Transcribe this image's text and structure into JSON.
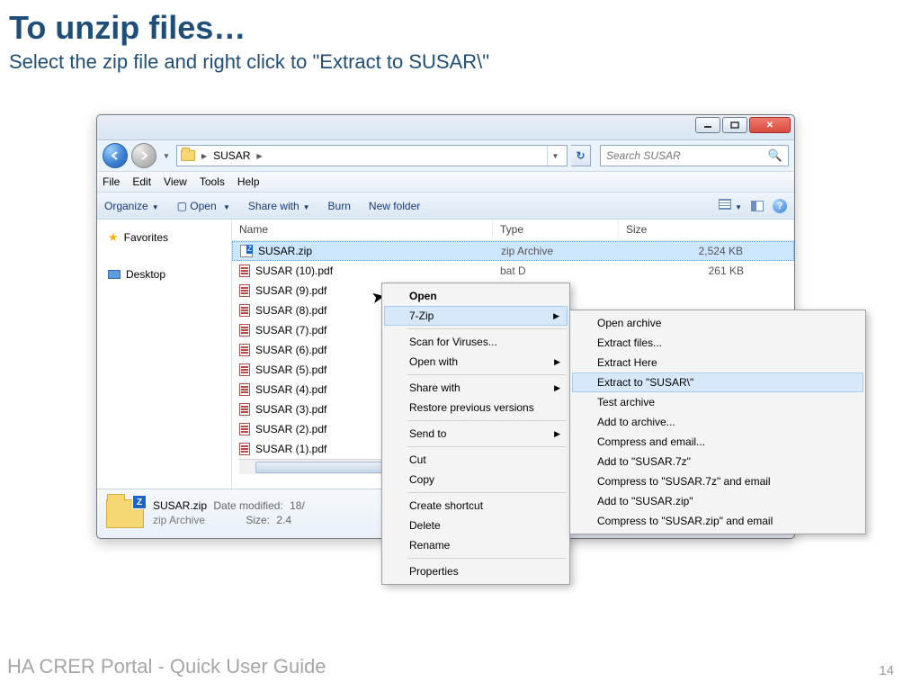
{
  "slide": {
    "title": "To unzip files…",
    "subtitle": "Select the zip file and right click to \"Extract to SUSAR\\\"",
    "footer": "HA CRER Portal - Quick User Guide",
    "pageno": "14"
  },
  "explorer": {
    "path_root": "SUSAR",
    "search_placeholder": "Search SUSAR",
    "menus": [
      "File",
      "Edit",
      "View",
      "Tools",
      "Help"
    ],
    "toolbar": {
      "organize": "Organize",
      "open": "Open",
      "share": "Share with",
      "burn": "Burn",
      "newfolder": "New folder"
    },
    "sidebar": {
      "favorites": "Favorites",
      "desktop": "Desktop"
    },
    "columns": {
      "name": "Name",
      "type": "Type",
      "size": "Size"
    },
    "files": [
      {
        "name": "SUSAR.zip",
        "type": "zip Archive",
        "size": "2,524 KB",
        "icon": "zip",
        "selected": true
      },
      {
        "name": "SUSAR (10).pdf",
        "type": "bat D",
        "size": "261 KB",
        "icon": "pdf"
      },
      {
        "name": "SUSAR (9).pdf",
        "icon": "pdf"
      },
      {
        "name": "SUSAR (8).pdf",
        "icon": "pdf"
      },
      {
        "name": "SUSAR (7).pdf",
        "icon": "pdf"
      },
      {
        "name": "SUSAR (6).pdf",
        "icon": "pdf"
      },
      {
        "name": "SUSAR (5).pdf",
        "icon": "pdf"
      },
      {
        "name": "SUSAR (4).pdf",
        "icon": "pdf"
      },
      {
        "name": "SUSAR (3).pdf",
        "icon": "pdf"
      },
      {
        "name": "SUSAR (2).pdf",
        "icon": "pdf"
      },
      {
        "name": "SUSAR (1).pdf",
        "icon": "pdf"
      }
    ],
    "details": {
      "name": "SUSAR.zip",
      "type": "zip Archive",
      "date_label": "Date modified:",
      "date_value": "18/",
      "size_label": "Size:",
      "size_value": "2.4"
    }
  },
  "context_menu": [
    {
      "label": "Open",
      "bold": true
    },
    {
      "label": "7-Zip",
      "submenu": true,
      "highlight": true
    },
    {
      "sep": true
    },
    {
      "label": "Scan for Viruses..."
    },
    {
      "label": "Open with",
      "submenu": true
    },
    {
      "sep": true
    },
    {
      "label": "Share with",
      "submenu": true
    },
    {
      "label": "Restore previous versions"
    },
    {
      "sep": true
    },
    {
      "label": "Send to",
      "submenu": true
    },
    {
      "sep": true
    },
    {
      "label": "Cut"
    },
    {
      "label": "Copy"
    },
    {
      "sep": true
    },
    {
      "label": "Create shortcut"
    },
    {
      "label": "Delete"
    },
    {
      "label": "Rename"
    },
    {
      "sep": true
    },
    {
      "label": "Properties"
    }
  ],
  "submenu_7zip": [
    {
      "label": "Open archive"
    },
    {
      "label": "Extract files..."
    },
    {
      "label": "Extract Here"
    },
    {
      "label": "Extract to \"SUSAR\\\"",
      "highlight": true
    },
    {
      "label": "Test archive"
    },
    {
      "label": "Add to archive..."
    },
    {
      "label": "Compress and email..."
    },
    {
      "label": "Add to \"SUSAR.7z\""
    },
    {
      "label": "Compress to \"SUSAR.7z\" and email"
    },
    {
      "label": "Add to \"SUSAR.zip\""
    },
    {
      "label": "Compress to \"SUSAR.zip\" and email"
    }
  ]
}
